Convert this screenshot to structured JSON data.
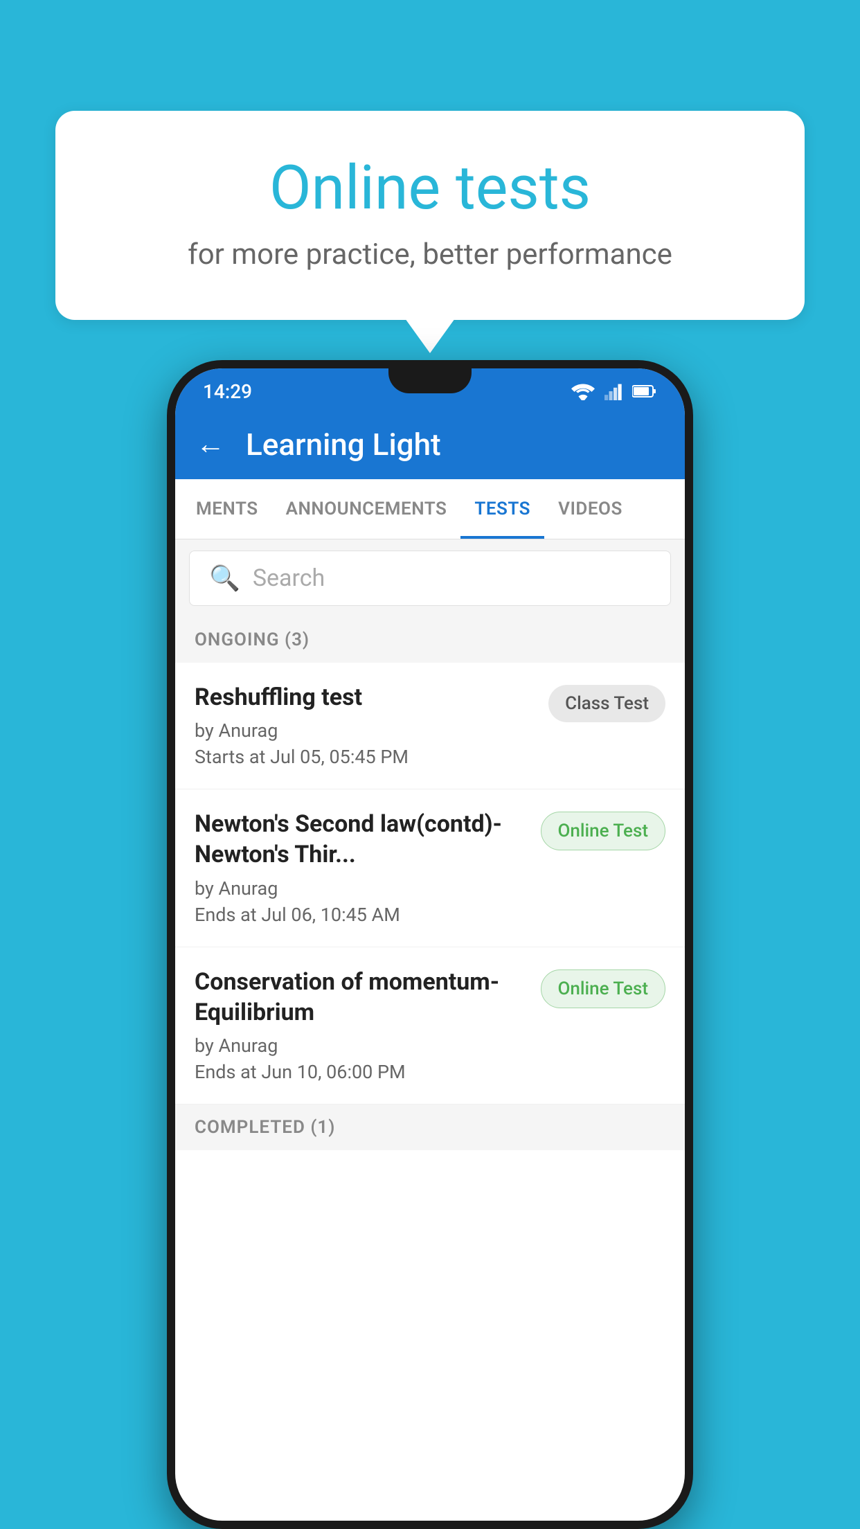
{
  "background_color": "#29b6d8",
  "promo": {
    "title": "Online tests",
    "subtitle": "for more practice, better performance"
  },
  "status_bar": {
    "time": "14:29",
    "icons": [
      "wifi",
      "signal",
      "battery"
    ]
  },
  "app_bar": {
    "title": "Learning Light",
    "back_label": "←"
  },
  "tabs": [
    {
      "label": "MENTS",
      "active": false
    },
    {
      "label": "ANNOUNCEMENTS",
      "active": false
    },
    {
      "label": "TESTS",
      "active": true
    },
    {
      "label": "VIDEOS",
      "active": false
    }
  ],
  "search": {
    "placeholder": "Search"
  },
  "ongoing_section": {
    "label": "ONGOING (3)"
  },
  "tests": [
    {
      "name": "Reshuffling test",
      "by": "by Anurag",
      "time_label": "Starts at",
      "time": "Jul 05, 05:45 PM",
      "badge": "Class Test",
      "badge_type": "class"
    },
    {
      "name": "Newton's Second law(contd)-Newton's Thir...",
      "by": "by Anurag",
      "time_label": "Ends at",
      "time": "Jul 06, 10:45 AM",
      "badge": "Online Test",
      "badge_type": "online"
    },
    {
      "name": "Conservation of momentum-Equilibrium",
      "by": "by Anurag",
      "time_label": "Ends at",
      "time": "Jun 10, 06:00 PM",
      "badge": "Online Test",
      "badge_type": "online"
    }
  ],
  "completed_section": {
    "label": "COMPLETED (1)"
  }
}
